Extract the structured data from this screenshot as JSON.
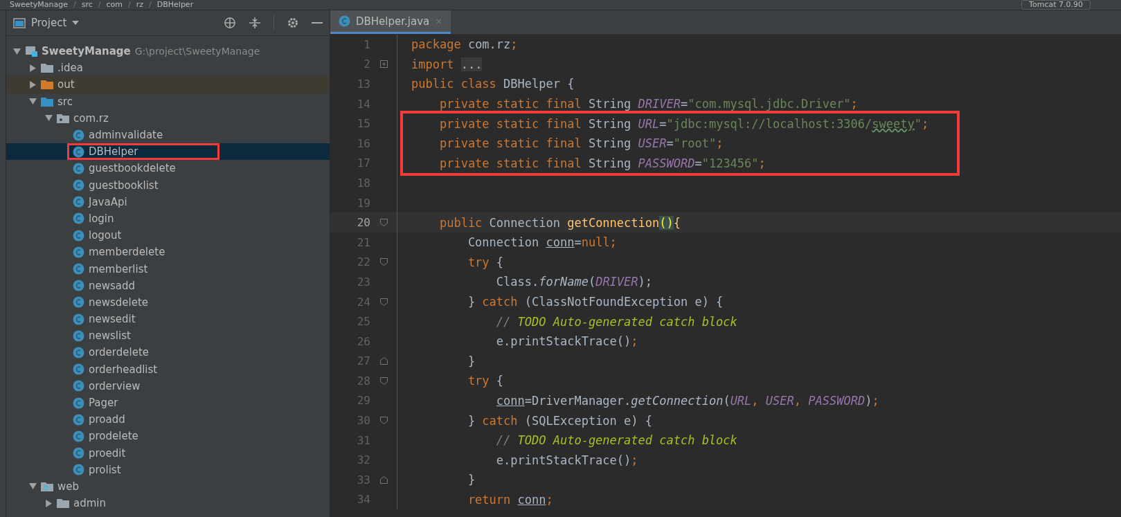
{
  "breadcrumbs": [
    "SweetyManage",
    "src",
    "com",
    "rz",
    "DBHelper"
  ],
  "breadcrumb_separator": "/",
  "run_config": {
    "label": "Tomcat 7.0.90"
  },
  "project_panel": {
    "title": "Project"
  },
  "tree": [
    {
      "label": "SweetyManage",
      "path": "G:\\project\\SweetyManage",
      "kind": "module",
      "expanded": true,
      "selected": false,
      "boxed": false,
      "children": [
        {
          "label": ".idea",
          "kind": "folder",
          "expanded": false,
          "selected": false,
          "boxed": false
        },
        {
          "label": "out",
          "kind": "excluded",
          "expanded": false,
          "selected": false,
          "boxed": false
        },
        {
          "label": "src",
          "kind": "source",
          "expanded": true,
          "selected": false,
          "boxed": false,
          "children": [
            {
              "label": "com.rz",
              "kind": "package",
              "expanded": true,
              "selected": false,
              "boxed": false,
              "children": [
                {
                  "label": "adminvalidate",
                  "kind": "class",
                  "selected": false,
                  "boxed": false
                },
                {
                  "label": "DBHelper",
                  "kind": "class",
                  "selected": true,
                  "boxed": true
                },
                {
                  "label": "guestbookdelete",
                  "kind": "class",
                  "selected": false,
                  "boxed": false
                },
                {
                  "label": "guestbooklist",
                  "kind": "class",
                  "selected": false,
                  "boxed": false
                },
                {
                  "label": "JavaApi",
                  "kind": "class",
                  "selected": false,
                  "boxed": false
                },
                {
                  "label": "login",
                  "kind": "class",
                  "selected": false,
                  "boxed": false
                },
                {
                  "label": "logout",
                  "kind": "class",
                  "selected": false,
                  "boxed": false
                },
                {
                  "label": "memberdelete",
                  "kind": "class",
                  "selected": false,
                  "boxed": false
                },
                {
                  "label": "memberlist",
                  "kind": "class",
                  "selected": false,
                  "boxed": false
                },
                {
                  "label": "newsadd",
                  "kind": "class",
                  "selected": false,
                  "boxed": false
                },
                {
                  "label": "newsdelete",
                  "kind": "class",
                  "selected": false,
                  "boxed": false
                },
                {
                  "label": "newsedit",
                  "kind": "class",
                  "selected": false,
                  "boxed": false
                },
                {
                  "label": "newslist",
                  "kind": "class",
                  "selected": false,
                  "boxed": false
                },
                {
                  "label": "orderdelete",
                  "kind": "class",
                  "selected": false,
                  "boxed": false
                },
                {
                  "label": "orderheadlist",
                  "kind": "class",
                  "selected": false,
                  "boxed": false
                },
                {
                  "label": "orderview",
                  "kind": "class",
                  "selected": false,
                  "boxed": false
                },
                {
                  "label": "Pager",
                  "kind": "class",
                  "selected": false,
                  "boxed": false
                },
                {
                  "label": "proadd",
                  "kind": "class",
                  "selected": false,
                  "boxed": false
                },
                {
                  "label": "prodelete",
                  "kind": "class",
                  "selected": false,
                  "boxed": false
                },
                {
                  "label": "proedit",
                  "kind": "class",
                  "selected": false,
                  "boxed": false
                },
                {
                  "label": "prolist",
                  "kind": "class",
                  "selected": false,
                  "boxed": false
                }
              ]
            }
          ]
        },
        {
          "label": "web",
          "kind": "web",
          "expanded": true,
          "selected": false,
          "boxed": false,
          "children": [
            {
              "label": "admin",
              "kind": "folder",
              "expanded": false,
              "selected": false,
              "boxed": false
            }
          ]
        }
      ]
    }
  ],
  "tabs": [
    {
      "label": "DBHelper.java",
      "close": "×",
      "selected": true
    }
  ],
  "code": [
    {
      "n": "1",
      "boxed": false,
      "current": false,
      "tokens": [
        {
          "t": "package ",
          "kind": "keyword"
        },
        {
          "t": "com.rz",
          "kind": "plain"
        },
        {
          "t": ";",
          "kind": "keyword"
        }
      ]
    },
    {
      "n": "2",
      "boxed": false,
      "current": false,
      "fold": {
        "kind": "collapsed"
      },
      "tokens": [
        {
          "t": "import ",
          "kind": "keyword"
        },
        {
          "t": "...",
          "kind": "folded"
        }
      ]
    },
    {
      "n": "13",
      "boxed": false,
      "current": false,
      "tokens": [
        {
          "t": "public class ",
          "kind": "keyword"
        },
        {
          "t": "DBHelper {",
          "kind": "plain"
        }
      ]
    },
    {
      "n": "14",
      "boxed": false,
      "current": false,
      "tokens": [
        {
          "t": "    private static final ",
          "kind": "keyword"
        },
        {
          "t": "String ",
          "kind": "plain"
        },
        {
          "t": "DRIVER",
          "kind": "constant"
        },
        {
          "t": "=",
          "kind": "plain"
        },
        {
          "t": "\"com.mysql.jdbc.Driver\"",
          "kind": "string"
        },
        {
          "t": ";",
          "kind": "keyword"
        }
      ]
    },
    {
      "n": "15",
      "boxed": true,
      "current": false,
      "tokens": [
        {
          "t": "    private static final ",
          "kind": "keyword"
        },
        {
          "t": "String ",
          "kind": "plain"
        },
        {
          "t": "URL",
          "kind": "constant"
        },
        {
          "t": "=",
          "kind": "plain"
        },
        {
          "t": "\"jdbc:mysql://localhost:3306/",
          "kind": "string"
        },
        {
          "t": "sweety",
          "kind": "typo"
        },
        {
          "t": "\"",
          "kind": "string"
        },
        {
          "t": ";",
          "kind": "keyword"
        }
      ]
    },
    {
      "n": "16",
      "boxed": true,
      "current": false,
      "tokens": [
        {
          "t": "    private static final ",
          "kind": "keyword"
        },
        {
          "t": "String ",
          "kind": "plain"
        },
        {
          "t": "USER",
          "kind": "constant"
        },
        {
          "t": "=",
          "kind": "plain"
        },
        {
          "t": "\"root\"",
          "kind": "string"
        },
        {
          "t": ";",
          "kind": "keyword"
        }
      ]
    },
    {
      "n": "17",
      "boxed": true,
      "current": false,
      "tokens": [
        {
          "t": "    private static final ",
          "kind": "keyword"
        },
        {
          "t": "String ",
          "kind": "plain"
        },
        {
          "t": "PASSWORD",
          "kind": "constant"
        },
        {
          "t": "=",
          "kind": "plain"
        },
        {
          "t": "\"123456\"",
          "kind": "string"
        },
        {
          "t": ";",
          "kind": "keyword"
        }
      ]
    },
    {
      "n": "18",
      "boxed": false,
      "current": false
    },
    {
      "n": "19",
      "boxed": false,
      "current": false
    },
    {
      "n": "20",
      "boxed": false,
      "current": true,
      "fold": {
        "kind": "open"
      },
      "tokens": [
        {
          "t": "    public ",
          "kind": "keyword"
        },
        {
          "t": "Connection ",
          "kind": "plain"
        },
        {
          "t": "getConnection",
          "kind": "method"
        },
        {
          "t": "()",
          "kind": "brace"
        },
        {
          "t": "{",
          "kind": "method"
        }
      ]
    },
    {
      "n": "21",
      "boxed": false,
      "current": false,
      "tokens": [
        {
          "t": "        Connection ",
          "kind": "plain"
        },
        {
          "t": "conn",
          "kind": "var"
        },
        {
          "t": "=",
          "kind": "plain"
        },
        {
          "t": "null;",
          "kind": "keyword"
        }
      ]
    },
    {
      "n": "22",
      "boxed": false,
      "current": false,
      "fold": {
        "kind": "open"
      },
      "tokens": [
        {
          "t": "        try ",
          "kind": "keyword"
        },
        {
          "t": "{",
          "kind": "plain"
        }
      ]
    },
    {
      "n": "23",
      "boxed": false,
      "current": false,
      "tokens": [
        {
          "t": "            Class.",
          "kind": "plain"
        },
        {
          "t": "forName",
          "kind": "static"
        },
        {
          "t": "(",
          "kind": "plain"
        },
        {
          "t": "DRIVER",
          "kind": "constant"
        },
        {
          "t": ");",
          "kind": "plain"
        }
      ]
    },
    {
      "n": "24",
      "boxed": false,
      "current": false,
      "fold": {
        "kind": "open"
      },
      "tokens": [
        {
          "t": "        } ",
          "kind": "plain"
        },
        {
          "t": "catch ",
          "kind": "keyword"
        },
        {
          "t": "(ClassNotFoundException e) {",
          "kind": "plain"
        }
      ]
    },
    {
      "n": "25",
      "boxed": false,
      "current": false,
      "tokens": [
        {
          "t": "            // ",
          "kind": "comment"
        },
        {
          "t": "TODO Auto-generated catch block",
          "kind": "todo"
        }
      ]
    },
    {
      "n": "26",
      "boxed": false,
      "current": false,
      "tokens": [
        {
          "t": "            e.printStackTrace()",
          "kind": "plain"
        },
        {
          "t": ";",
          "kind": "keyword"
        }
      ]
    },
    {
      "n": "27",
      "boxed": false,
      "current": false,
      "fold": {
        "kind": "close"
      },
      "tokens": [
        {
          "t": "        }",
          "kind": "plain"
        }
      ]
    },
    {
      "n": "28",
      "boxed": false,
      "current": false,
      "fold": {
        "kind": "open"
      },
      "tokens": [
        {
          "t": "        try ",
          "kind": "keyword"
        },
        {
          "t": "{",
          "kind": "plain"
        }
      ]
    },
    {
      "n": "29",
      "boxed": false,
      "current": false,
      "tokens": [
        {
          "t": "            conn",
          "kind": "var"
        },
        {
          "t": "=DriverManager.",
          "kind": "plain"
        },
        {
          "t": "getConnection",
          "kind": "static"
        },
        {
          "t": "(",
          "kind": "plain"
        },
        {
          "t": "URL",
          "kind": "constant"
        },
        {
          "t": ", ",
          "kind": "keyword"
        },
        {
          "t": "USER",
          "kind": "constant"
        },
        {
          "t": ", ",
          "kind": "keyword"
        },
        {
          "t": "PASSWORD",
          "kind": "constant"
        },
        {
          "t": ")",
          "kind": "plain"
        },
        {
          "t": ";",
          "kind": "keyword"
        }
      ]
    },
    {
      "n": "30",
      "boxed": false,
      "current": false,
      "fold": {
        "kind": "open"
      },
      "tokens": [
        {
          "t": "        } ",
          "kind": "plain"
        },
        {
          "t": "catch ",
          "kind": "keyword"
        },
        {
          "t": "(SQLException e) {",
          "kind": "plain"
        }
      ]
    },
    {
      "n": "31",
      "boxed": false,
      "current": false,
      "tokens": [
        {
          "t": "            // ",
          "kind": "comment"
        },
        {
          "t": "TODO Auto-generated catch block",
          "kind": "todo"
        }
      ]
    },
    {
      "n": "32",
      "boxed": false,
      "current": false,
      "tokens": [
        {
          "t": "            e.printStackTrace()",
          "kind": "plain"
        },
        {
          "t": ";",
          "kind": "keyword"
        }
      ]
    },
    {
      "n": "33",
      "boxed": false,
      "current": false,
      "fold": {
        "kind": "close"
      },
      "tokens": [
        {
          "t": "        }",
          "kind": "plain"
        }
      ]
    },
    {
      "n": "34",
      "boxed": false,
      "current": false,
      "tokens": [
        {
          "t": "        return ",
          "kind": "keyword"
        },
        {
          "t": "conn",
          "kind": "var"
        },
        {
          "t": ";",
          "kind": "keyword"
        }
      ]
    }
  ]
}
